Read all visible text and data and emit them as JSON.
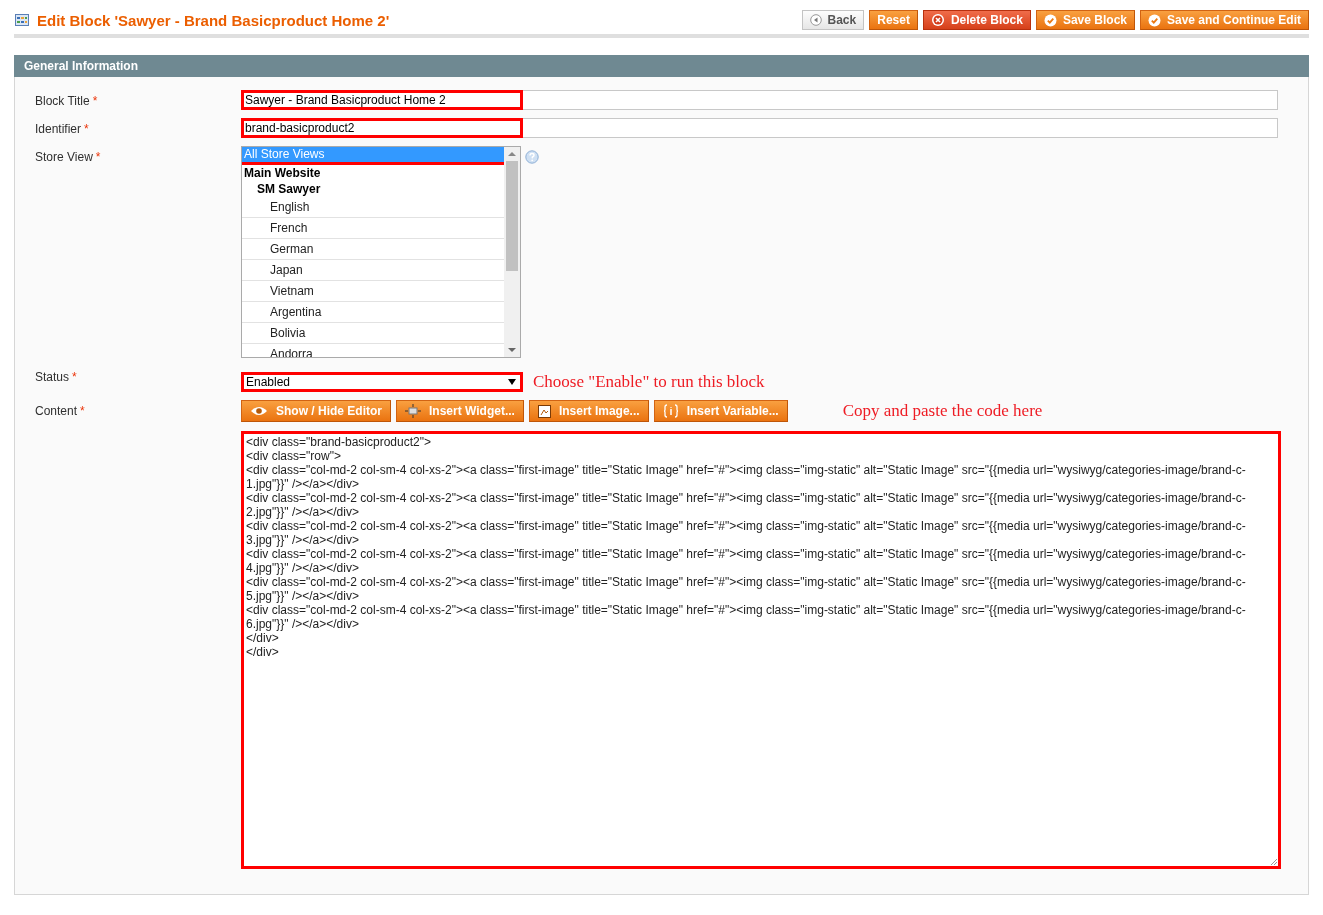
{
  "page_title": "Edit Block 'Sawyer - Brand Basicproduct Home 2'",
  "actions": [
    {
      "label": "Back",
      "kind": "back"
    },
    {
      "label": "Reset",
      "kind": "plain"
    },
    {
      "label": "Delete Block",
      "kind": "danger"
    },
    {
      "label": "Save Block",
      "kind": "save"
    },
    {
      "label": "Save and Continue Edit",
      "kind": "save"
    }
  ],
  "section_title": "General Information",
  "fields": {
    "block_title": {
      "label": "Block Title",
      "required_mark": "*",
      "value": "Sawyer - Brand Basicproduct Home 2"
    },
    "identifier": {
      "label": "Identifier",
      "required_mark": "*",
      "value": "brand-basicproduct2"
    },
    "store_view": {
      "label": "Store View",
      "required_mark": "*",
      "options": [
        {
          "label": "All Store Views",
          "selected": true,
          "kind": "option"
        },
        {
          "label": "Main Website",
          "kind": "group",
          "children": [
            {
              "label": "SM Sawyer",
              "kind": "group",
              "children": [
                {
                  "label": "English",
                  "selected": false,
                  "kind": "option"
                },
                {
                  "label": "French",
                  "selected": false,
                  "kind": "option"
                },
                {
                  "label": "German",
                  "selected": false,
                  "kind": "option"
                },
                {
                  "label": "Japan",
                  "selected": false,
                  "kind": "option"
                },
                {
                  "label": "Vietnam",
                  "selected": false,
                  "kind": "option"
                },
                {
                  "label": "Argentina",
                  "selected": false,
                  "kind": "option"
                },
                {
                  "label": "Bolivia",
                  "selected": false,
                  "kind": "option"
                },
                {
                  "label": "Andorra",
                  "selected": false,
                  "kind": "option"
                }
              ]
            }
          ]
        }
      ]
    },
    "status": {
      "label": "Status",
      "required_mark": "*",
      "value": "Enabled"
    },
    "content": {
      "label": "Content",
      "required_mark": "*",
      "editor_buttons": [
        {
          "label": "Show / Hide Editor",
          "kind": "eye"
        },
        {
          "label": "Insert Widget...",
          "kind": "widget"
        },
        {
          "label": "Insert Image...",
          "kind": "image"
        },
        {
          "label": "Insert Variable...",
          "kind": "variable"
        }
      ],
      "lines": [
        "<div class=\"brand-basicproduct2\">",
        "<div class=\"row\">",
        "<div class=\"col-md-2 col-sm-4 col-xs-2\"><a class=\"first-image\" title=\"Static Image\" href=\"#\"><img class=\"img-static\" alt=\"Static Image\" src=\"{{media url=\"wysiwyg/categories-image/brand-c-",
        "1.jpg\"}}\" /></a></div>",
        "<div class=\"col-md-2 col-sm-4 col-xs-2\"><a class=\"first-image\" title=\"Static Image\" href=\"#\"><img class=\"img-static\" alt=\"Static Image\" src=\"{{media url=\"wysiwyg/categories-image/brand-c-",
        "2.jpg\"}}\" /></a></div>",
        "<div class=\"col-md-2 col-sm-4 col-xs-2\"><a class=\"first-image\" title=\"Static Image\" href=\"#\"><img class=\"img-static\" alt=\"Static Image\" src=\"{{media url=\"wysiwyg/categories-image/brand-c-",
        "3.jpg\"}}\" /></a></div>",
        "<div class=\"col-md-2 col-sm-4 col-xs-2\"><a class=\"first-image\" title=\"Static Image\" href=\"#\"><img class=\"img-static\" alt=\"Static Image\" src=\"{{media url=\"wysiwyg/categories-image/brand-c-",
        "4.jpg\"}}\" /></a></div>",
        "<div class=\"col-md-2 col-sm-4 col-xs-2\"><a class=\"first-image\" title=\"Static Image\" href=\"#\"><img class=\"img-static\" alt=\"Static Image\" src=\"{{media url=\"wysiwyg/categories-image/brand-c-",
        "5.jpg\"}}\" /></a></div>",
        "<div class=\"col-md-2 col-sm-4 col-xs-2\"><a class=\"first-image\" title=\"Static Image\" href=\"#\"><img class=\"img-static\" alt=\"Static Image\" src=\"{{media url=\"wysiwyg/categories-image/brand-c-",
        "6.jpg\"}}\" /></a></div>",
        "</div>",
        "</div>"
      ]
    }
  },
  "annotations": {
    "status": "Choose \"Enable\" to run this block",
    "content": "Copy and paste the code here"
  }
}
